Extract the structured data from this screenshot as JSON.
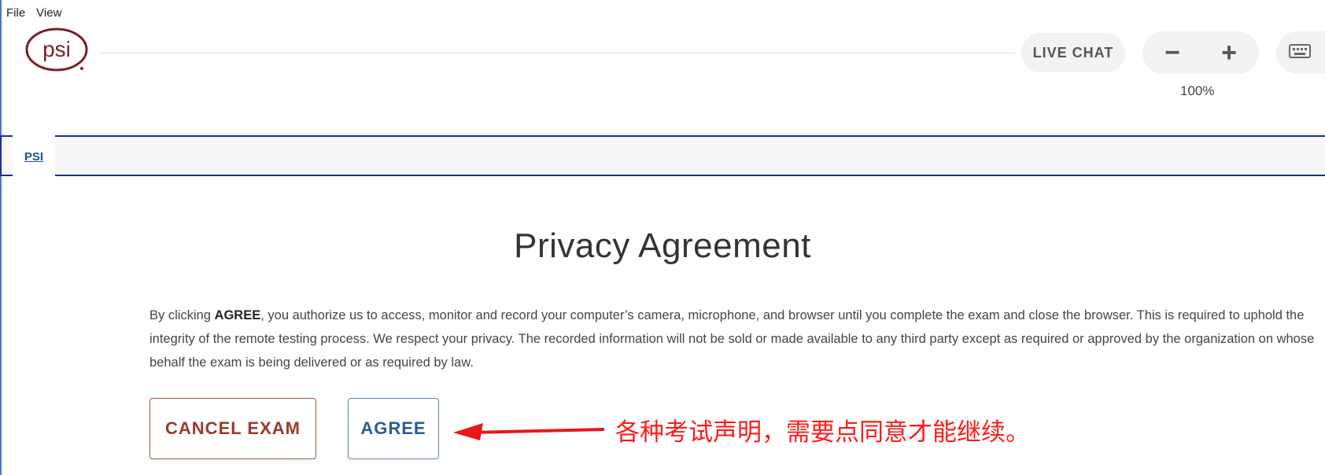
{
  "menubar": {
    "file": "File",
    "view": "View"
  },
  "header": {
    "logo_text": "psi",
    "live_chat_label": "LIVE CHAT",
    "zoom_out_label": "−",
    "zoom_in_label": "+",
    "zoom_level": "100%",
    "keyboard_icon": "keyboard-icon"
  },
  "tabs": [
    {
      "label": "PSI"
    }
  ],
  "page": {
    "title": "Privacy Agreement",
    "agreement": {
      "prefix": "By clicking ",
      "bold": "AGREE",
      "rest": ", you authorize us to access, monitor and record your computer’s camera, microphone, and browser until you complete the exam and close the browser. This is required to uphold the integrity of the remote testing process. We respect your privacy. The recorded information will not be sold or made available to any third party except as required or approved by the organization on whose behalf the exam is being delivered or as required by law."
    },
    "cancel_label": "CANCEL EXAM",
    "agree_label": "AGREE"
  },
  "annotation": {
    "text": "各种考试声明，需要点同意才能继续。",
    "color": "#ff1a1a"
  },
  "colors": {
    "accent_blue": "#1e2aa8",
    "cancel_red": "#9a3a2c",
    "agree_blue": "#2a5a94",
    "logo_red": "#7a1f2a"
  }
}
